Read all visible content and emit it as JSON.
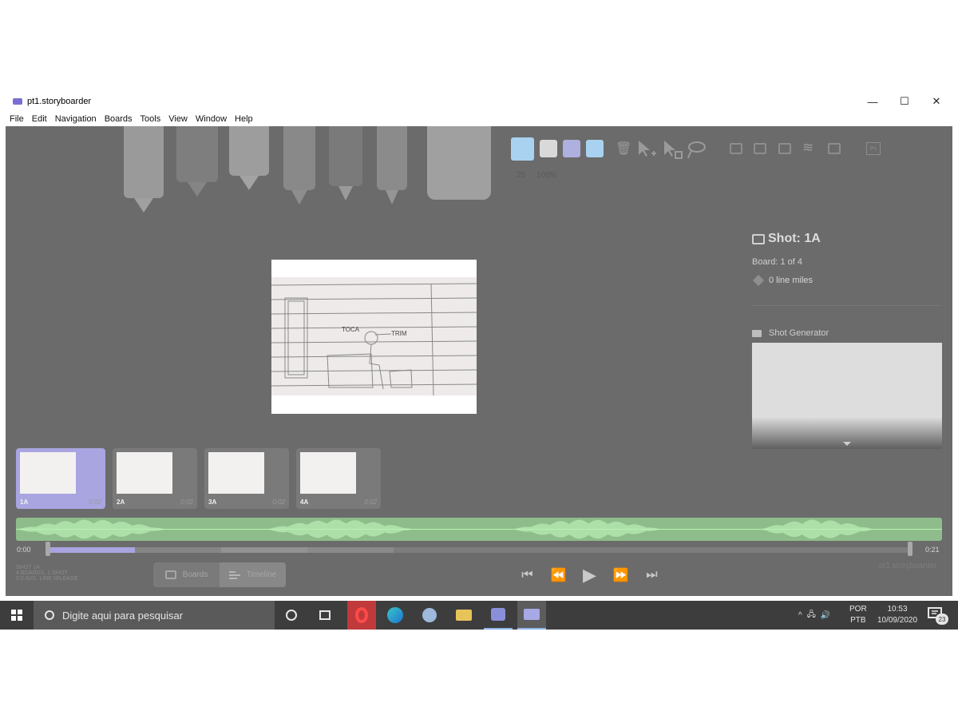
{
  "window": {
    "title": "pt1.storyboarder",
    "controls": {
      "minimize": "—",
      "maximize": "☐",
      "close": "✕"
    }
  },
  "menu": [
    "File",
    "Edit",
    "Navigation",
    "Boards",
    "Tools",
    "View",
    "Window",
    "Help"
  ],
  "toolbar": {
    "brush_size": "20",
    "brush_opacity": "100%",
    "palette": [
      "#a8d2f0",
      "#d9d9d9",
      "#aeb0df",
      "#a8d2f0"
    ],
    "ps_label": "Ps"
  },
  "shot_panel": {
    "title": "Shot: 1A",
    "board_count": "Board: 1 of 4",
    "line_miles": "0 line miles",
    "shot_generator_label": "Shot Generator"
  },
  "boards": [
    {
      "label": "1A",
      "duration": "0:02",
      "active": true
    },
    {
      "label": "2A",
      "duration": "0:02",
      "active": false
    },
    {
      "label": "3A",
      "duration": "0:02",
      "active": false
    },
    {
      "label": "4A",
      "duration": "0:02",
      "active": false
    }
  ],
  "timeline": {
    "start": "0:00",
    "end": "0:21"
  },
  "footer_info": [
    "SHOT 1A",
    "4 BOARDS, 1 SHOT",
    "0.0 AVG. LINE MILEAGE"
  ],
  "view_toggle": {
    "boards": "Boards",
    "timeline": "Timeline"
  },
  "watermark": "pt1.storyboarder",
  "taskbar": {
    "search_placeholder": "Digite aqui para pesquisar",
    "lang_1": "POR",
    "lang_2": "PTB",
    "time": "10:53",
    "date": "10/09/2020",
    "notifications": "23"
  },
  "sketch_labels": {
    "a": "TOCA",
    "b": "TRIM"
  }
}
